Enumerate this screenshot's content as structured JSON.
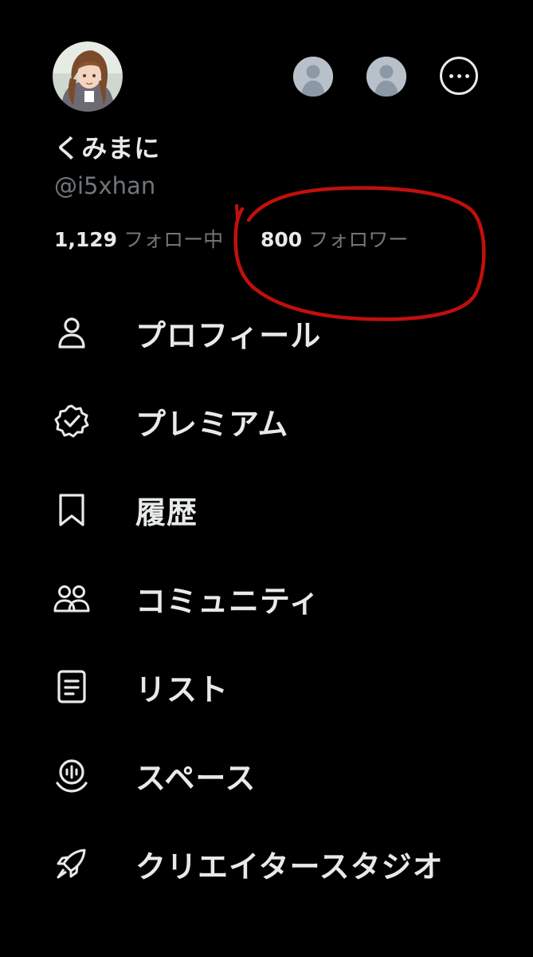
{
  "profile": {
    "display_name": "くみまに",
    "handle": "@i5xhan",
    "following_count": "1,129",
    "following_label": "フォロー中",
    "followers_count": "800",
    "followers_label": "フォロワー"
  },
  "menu": {
    "items": [
      {
        "label": "プロフィール",
        "icon": "person-icon"
      },
      {
        "label": "プレミアム",
        "icon": "verified-badge-icon"
      },
      {
        "label": "履歴",
        "icon": "bookmark-icon"
      },
      {
        "label": "コミュニティ",
        "icon": "people-icon"
      },
      {
        "label": "リスト",
        "icon": "list-icon"
      },
      {
        "label": "スペース",
        "icon": "microphone-icon"
      },
      {
        "label": "クリエイタースタジオ",
        "icon": "rocket-icon"
      }
    ]
  },
  "colors": {
    "background": "#000000",
    "text_primary": "#e7e9ea",
    "text_secondary": "#71767b",
    "annotation_red": "#c0100c"
  }
}
